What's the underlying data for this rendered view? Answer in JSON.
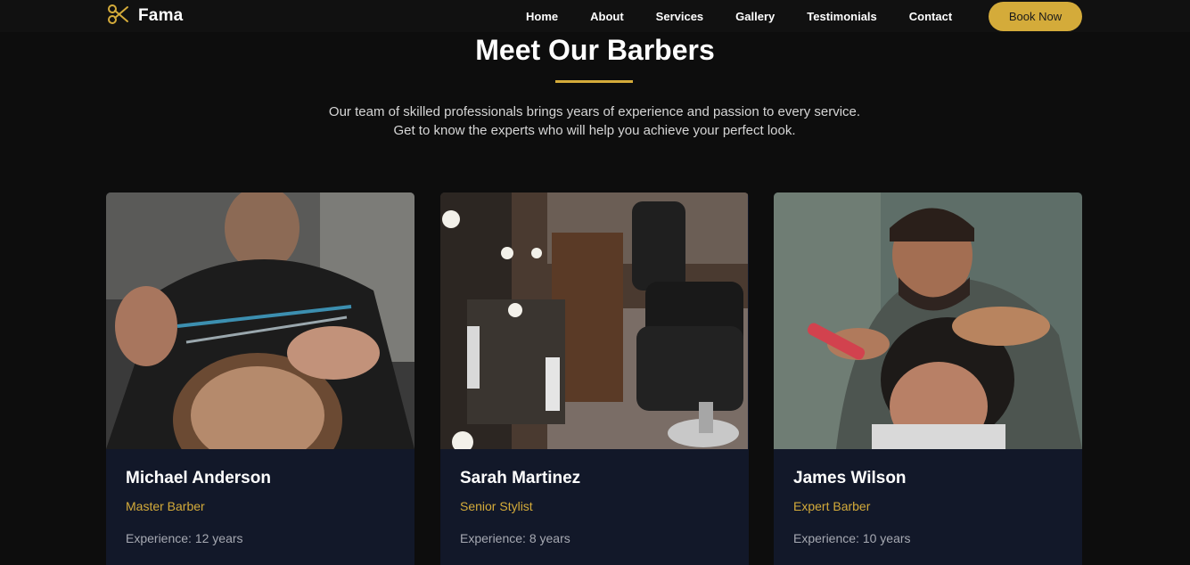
{
  "brand": {
    "name": "Fama",
    "icon": "scissors-icon",
    "accent_color": "#d4ab3a"
  },
  "nav": {
    "links": [
      "Home",
      "About",
      "Services",
      "Gallery",
      "Testimonials",
      "Contact"
    ],
    "cta_label": "Book Now"
  },
  "section": {
    "title": "Meet Our Barbers",
    "intro": "Our team of skilled professionals brings years of experience and passion to every service. Get to know the experts who will help you achieve your perfect look."
  },
  "barbers": [
    {
      "name": "Michael Anderson",
      "role": "Master Barber",
      "experience": "Experience: 12 years"
    },
    {
      "name": "Sarah Martinez",
      "role": "Senior Stylist",
      "experience": "Experience: 8 years"
    },
    {
      "name": "James Wilson",
      "role": "Expert Barber",
      "experience": "Experience: 10 years"
    }
  ]
}
